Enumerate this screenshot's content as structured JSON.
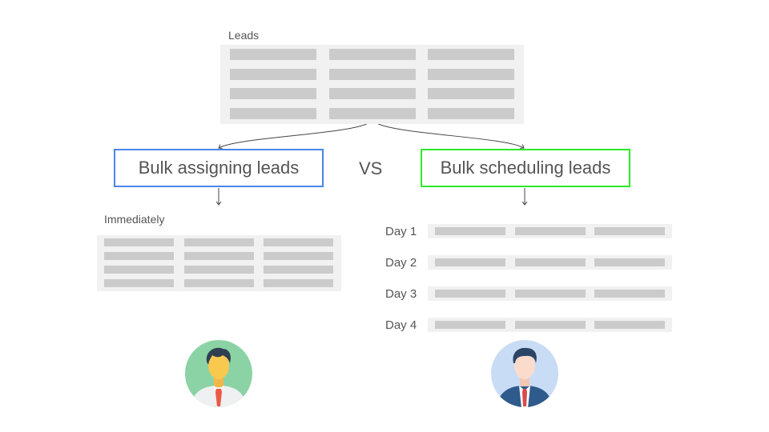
{
  "source": {
    "label": "Leads",
    "rows": 4,
    "columns": 3
  },
  "left_option": {
    "title": "Bulk assigning leads",
    "border_color": "#4a86e8",
    "timing_label": "Immediately",
    "rows": 4,
    "columns": 3,
    "avatar": "businessman-avatar-green-icon"
  },
  "comparison_label": "VS",
  "right_option": {
    "title": "Bulk scheduling leads",
    "border_color": "#2ee82a",
    "days": [
      {
        "label": "Day 1"
      },
      {
        "label": "Day 2"
      },
      {
        "label": "Day 3"
      },
      {
        "label": "Day 4"
      }
    ],
    "columns": 3,
    "avatar": "businessman-avatar-blue-icon"
  }
}
